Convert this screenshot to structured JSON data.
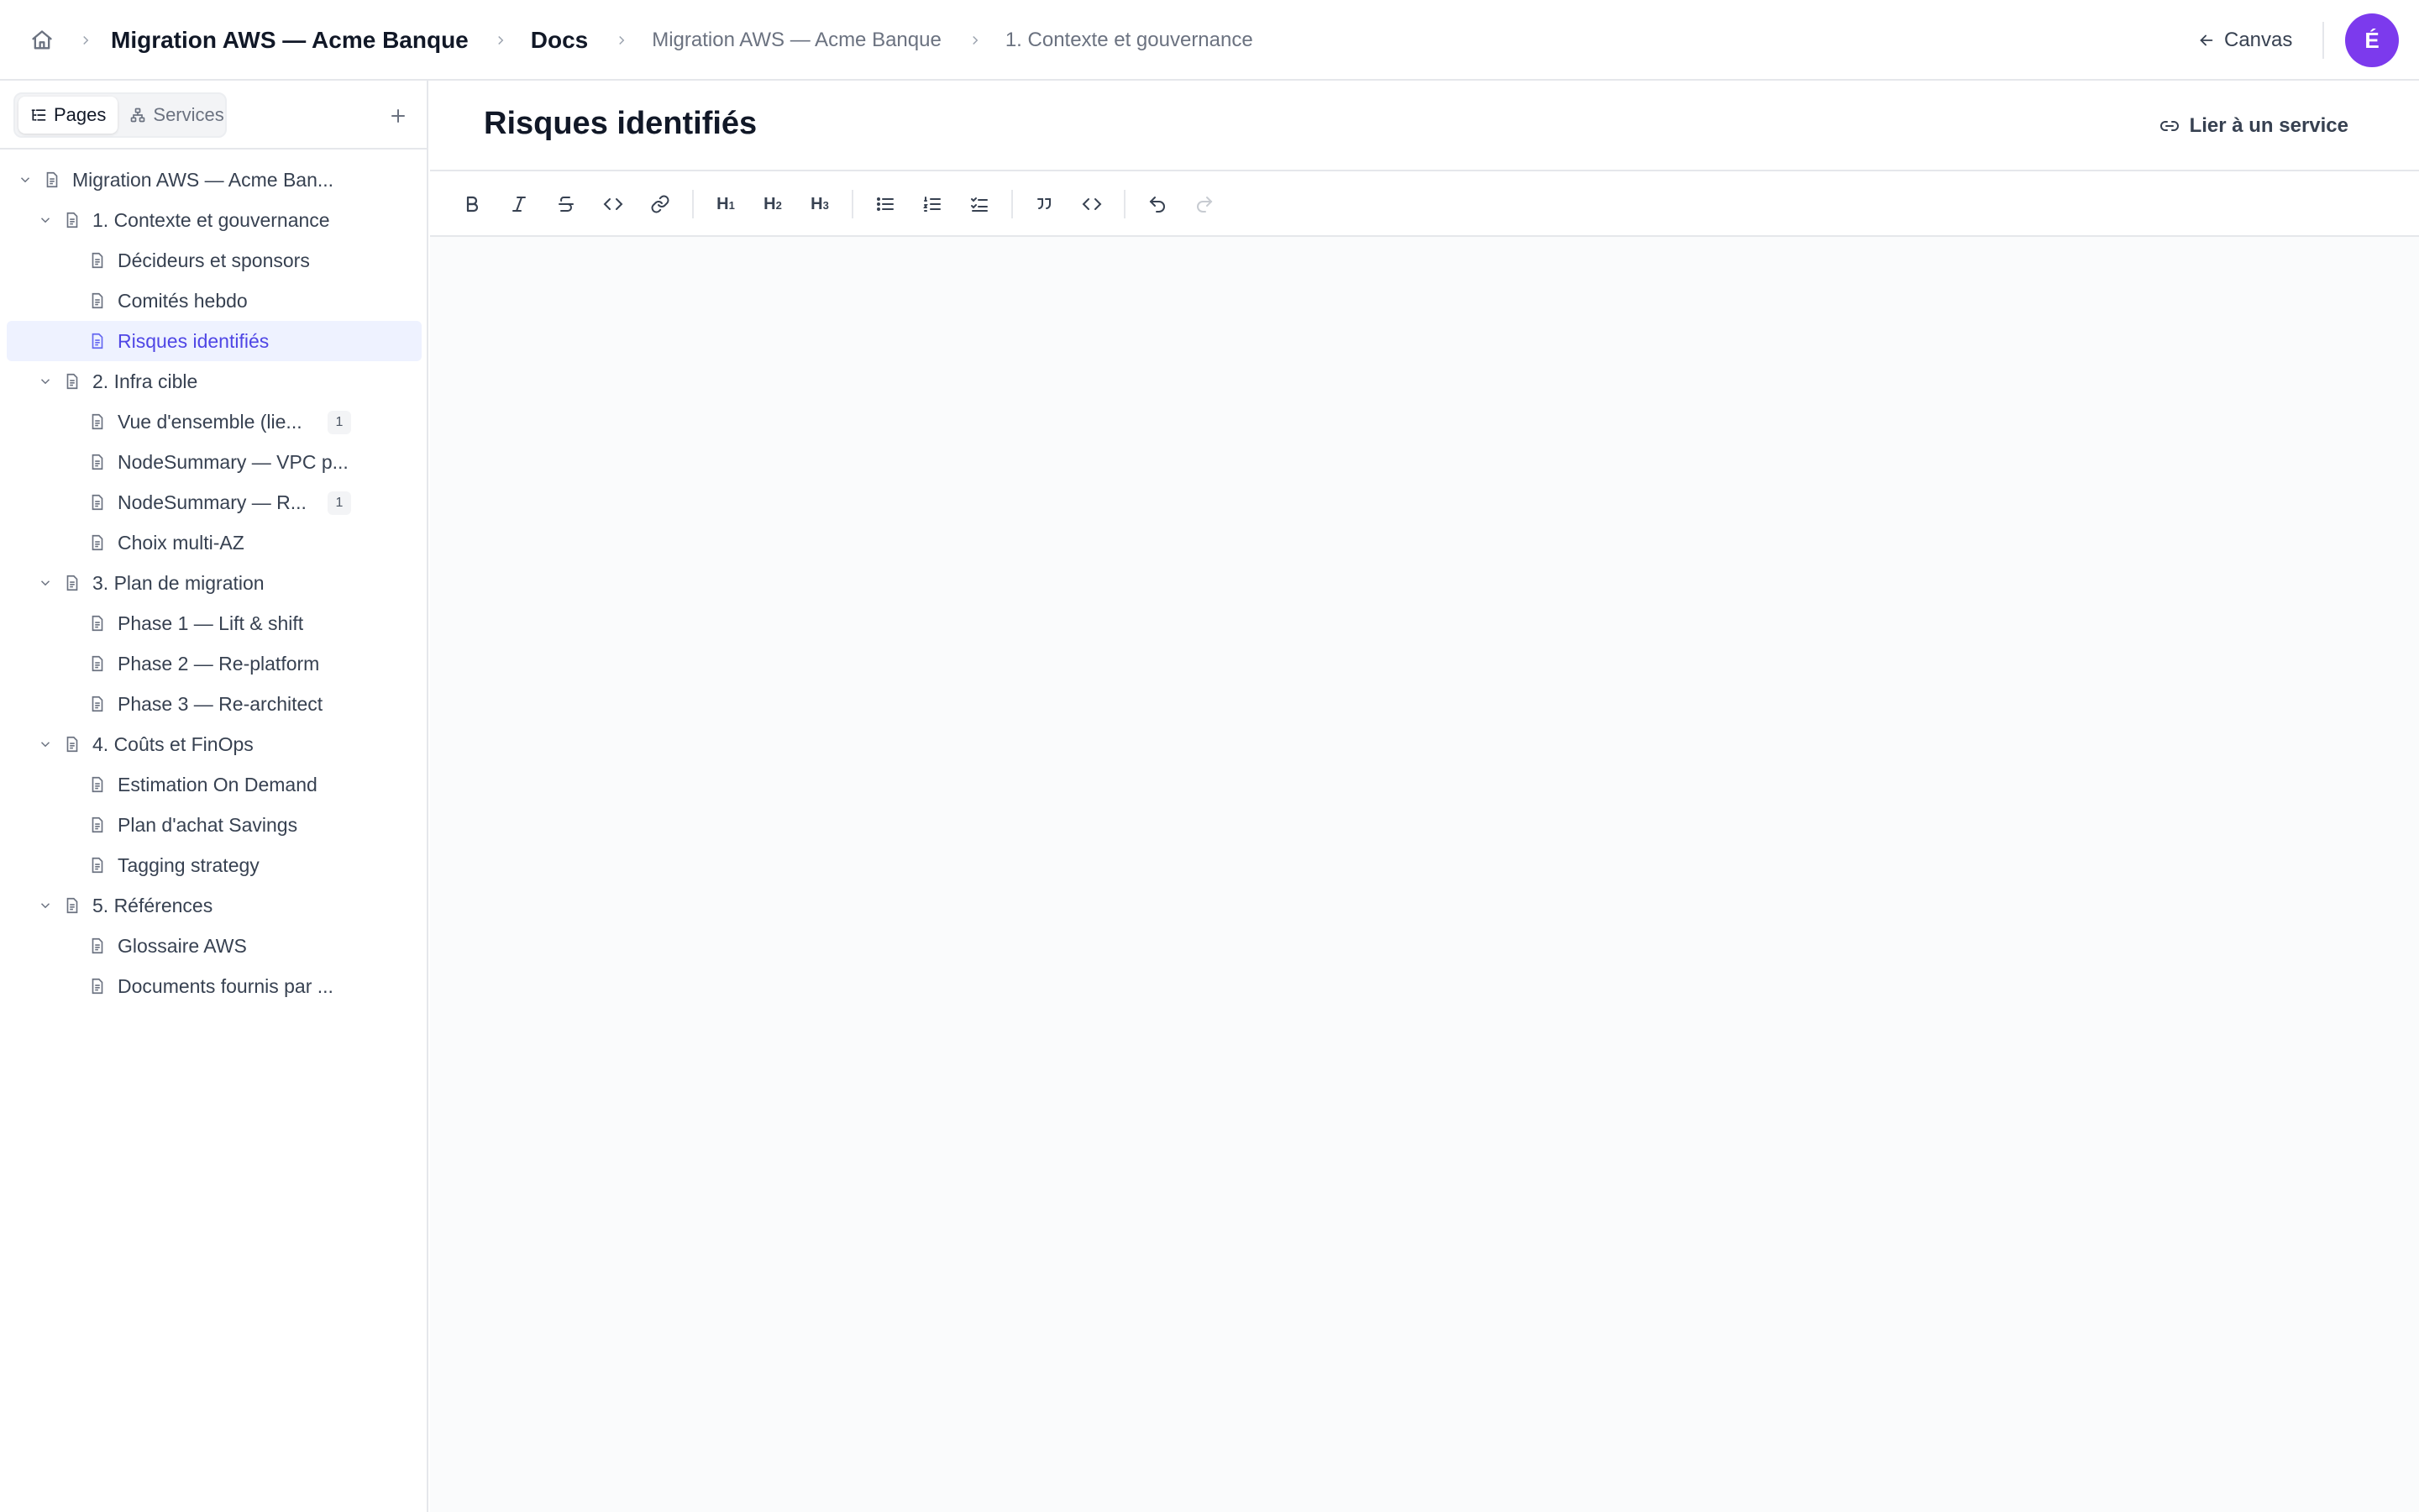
{
  "topbar": {
    "breadcrumb_project": "Migration AWS — Acme Banque",
    "breadcrumb_section": "Docs",
    "breadcrumb_doc": "Migration AWS — Acme Banque",
    "breadcrumb_page": "1. Contexte et gouvernance",
    "canvas_label": "Canvas",
    "avatar_initial": "É",
    "avatar_color": "#7c3aed"
  },
  "sidebar": {
    "tab_pages": "Pages",
    "tab_services": "Services",
    "tree": [
      {
        "label": "Migration AWS — Acme Ban...",
        "level": 0,
        "expandable": true
      },
      {
        "label": "1. Contexte et gouvernance",
        "level": 1,
        "expandable": true
      },
      {
        "label": "Décideurs et sponsors",
        "level": 2
      },
      {
        "label": "Comités hebdo",
        "level": 2
      },
      {
        "label": "Risques identifiés",
        "level": 2,
        "selected": true
      },
      {
        "label": "2. Infra cible",
        "level": 1,
        "expandable": true
      },
      {
        "label": "Vue d'ensemble (lie...",
        "level": 2,
        "badge": "1"
      },
      {
        "label": "NodeSummary — VPC p...",
        "level": 2
      },
      {
        "label": "NodeSummary — R...",
        "level": 2,
        "badge": "1"
      },
      {
        "label": "Choix multi-AZ",
        "level": 2
      },
      {
        "label": "3. Plan de migration",
        "level": 1,
        "expandable": true
      },
      {
        "label": "Phase 1 — Lift & shift",
        "level": 2
      },
      {
        "label": "Phase 2 — Re-platform",
        "level": 2
      },
      {
        "label": "Phase 3 — Re-architect",
        "level": 2
      },
      {
        "label": "4. Coûts et FinOps",
        "level": 1,
        "expandable": true
      },
      {
        "label": "Estimation On Demand",
        "level": 2
      },
      {
        "label": "Plan d'achat Savings",
        "level": 2
      },
      {
        "label": "Tagging strategy",
        "level": 2
      },
      {
        "label": "5. Références",
        "level": 1,
        "expandable": true
      },
      {
        "label": "Glossaire AWS",
        "level": 2
      },
      {
        "label": "Documents fournis par ...",
        "level": 2
      }
    ]
  },
  "main": {
    "page_title": "Risques identifiés",
    "link_service_label": "Lier à un service",
    "toolbar": {
      "h1": "H",
      "h1_sub": "1",
      "h2": "H",
      "h2_sub": "2",
      "h3": "H",
      "h3_sub": "3"
    }
  },
  "colors": {
    "accent": "#4f46e5",
    "selected_bg": "#eef2ff",
    "border": "#e5e7eb"
  }
}
